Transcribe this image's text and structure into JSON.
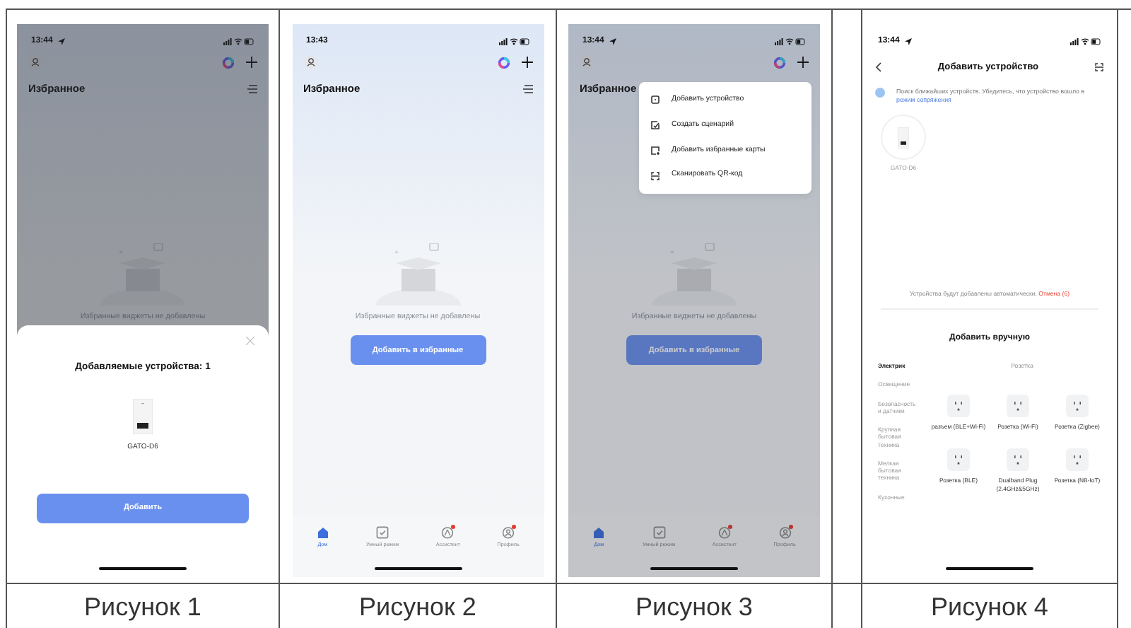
{
  "figures": [
    {
      "kind": "home",
      "caption": "Рисунок 1",
      "dimmed": true,
      "status_time": "13:44",
      "location_arrow": true,
      "title": "Избранное",
      "empty_text": "Избранные виджеты не добавлены",
      "sheet": {
        "title": "Добавляемые устройства: 1",
        "device": "GATO-D6",
        "button": "Добавить"
      }
    },
    {
      "kind": "home",
      "caption": "Рисунок 2",
      "dimmed": false,
      "status_time": "13:43",
      "location_arrow": false,
      "title": "Избранное",
      "empty_text": "Избранные виджеты не добавлены",
      "add_button": "Добавить в избранные",
      "tabs": [
        {
          "label": "Дом",
          "selected": true,
          "badge": false
        },
        {
          "label": "Умный режим",
          "selected": false,
          "badge": false
        },
        {
          "label": "Ассистент",
          "selected": false,
          "badge": true
        },
        {
          "label": "Профиль",
          "selected": false,
          "badge": true
        }
      ]
    },
    {
      "kind": "home",
      "caption": "Рисунок 3",
      "dimmed": true,
      "status_time": "13:44",
      "location_arrow": true,
      "title": "Избранное",
      "empty_text": "Избранные виджеты не добавлены",
      "add_button": "Добавить в избранные",
      "tabs": [
        {
          "label": "Дом",
          "selected": true,
          "badge": false
        },
        {
          "label": "Умный режим",
          "selected": false,
          "badge": false
        },
        {
          "label": "Ассистент",
          "selected": false,
          "badge": true
        },
        {
          "label": "Профиль",
          "selected": false,
          "badge": true
        }
      ],
      "menu": [
        {
          "kind": "device",
          "label": "Добавить устройство"
        },
        {
          "kind": "scenario",
          "label": "Создать сценарий"
        },
        {
          "kind": "cards",
          "label": "Добавить избранные карты"
        },
        {
          "kind": "scan",
          "label": "Сканировать QR-код"
        }
      ]
    },
    {
      "kind": "add_device",
      "caption": "Рисунок 4",
      "status_time": "13:44",
      "location_arrow": true,
      "title": "Добавить устройство",
      "info_text": "Поиск ближайших устройств. Убедитесь, что устройство вошло в",
      "info_link": "режим сопряжения",
      "device": "GATO-D6",
      "auto_text": "Устройства будут добавлены автоматически.",
      "cancel": "Отмена (6)",
      "manual_title": "Добавить вручную",
      "categories": [
        {
          "label": "Электрик",
          "selected": true
        },
        {
          "label": "Освещение",
          "selected": false
        },
        {
          "label": "Безопасность и датчики",
          "selected": false
        },
        {
          "label": "Крупная бытовая техника",
          "selected": false
        },
        {
          "label": "Мелкая бытовая техника",
          "selected": false
        },
        {
          "label": "Кухонные",
          "selected": false
        }
      ],
      "section": "Розетка",
      "products": [
        "разъем (BLE+Wi-Fi)",
        "Розетка (Wi-Fi)",
        "Розетка (Zigbee)",
        "Розетка (BLE)",
        "Dualband Plug (2.4GHz&5GHz)",
        "Розетка (NB-IoT)"
      ]
    }
  ]
}
